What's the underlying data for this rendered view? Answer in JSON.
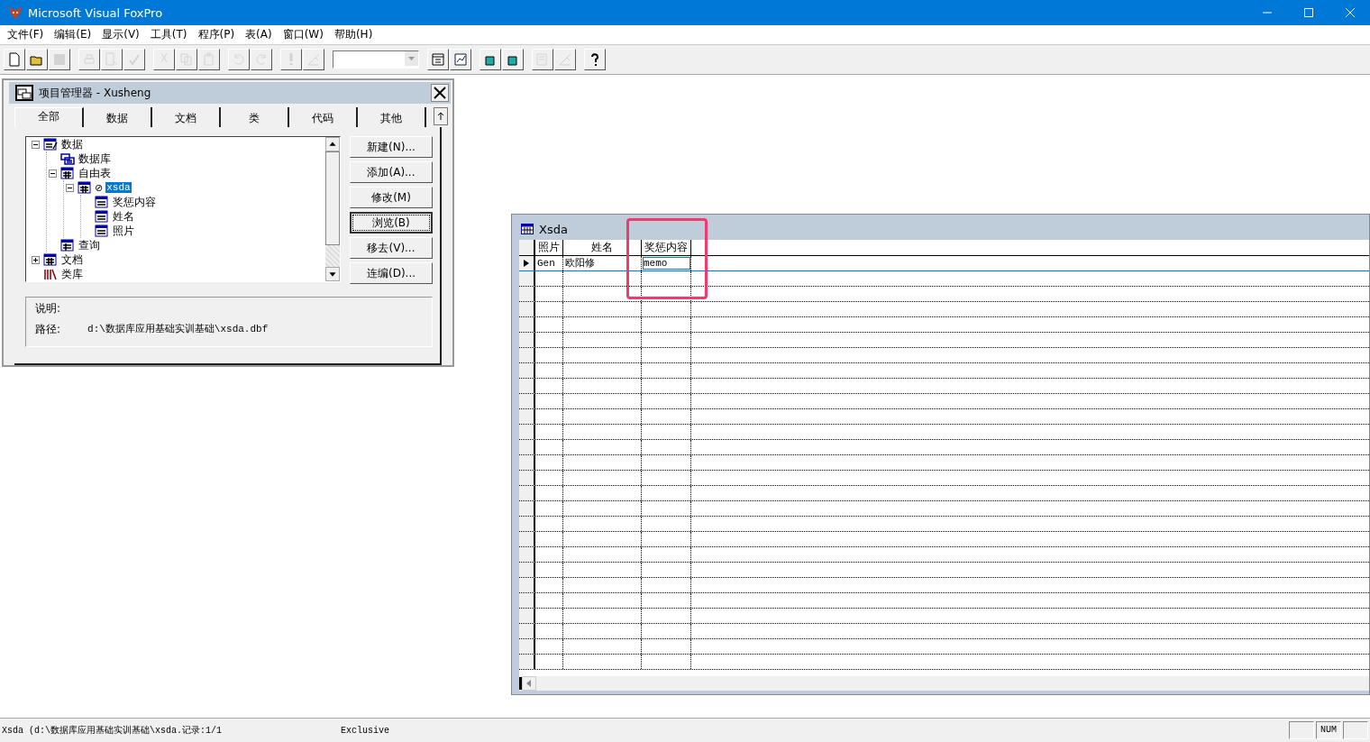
{
  "window": {
    "title": "Microsoft Visual FoxPro"
  },
  "menu": [
    "文件(F)",
    "编辑(E)",
    "显示(V)",
    "工具(T)",
    "程序(P)",
    "表(A)",
    "窗口(W)",
    "帮助(H)"
  ],
  "toolbar": [
    {
      "kind": "new",
      "disabled": false
    },
    {
      "kind": "open",
      "disabled": false
    },
    {
      "kind": "save",
      "disabled": true
    },
    {
      "kind": "sep"
    },
    {
      "kind": "print",
      "disabled": true
    },
    {
      "kind": "preview",
      "disabled": true
    },
    {
      "kind": "spell",
      "disabled": true
    },
    {
      "kind": "sep"
    },
    {
      "kind": "cut",
      "disabled": true
    },
    {
      "kind": "copy",
      "disabled": true
    },
    {
      "kind": "paste",
      "disabled": true
    },
    {
      "kind": "sep"
    },
    {
      "kind": "undo",
      "disabled": true
    },
    {
      "kind": "redo",
      "disabled": true
    },
    {
      "kind": "sep"
    },
    {
      "kind": "run",
      "disabled": true
    },
    {
      "kind": "modify",
      "disabled": true
    },
    {
      "kind": "sep"
    },
    {
      "kind": "combo"
    },
    {
      "kind": "sep"
    },
    {
      "kind": "window",
      "disabled": false
    },
    {
      "kind": "report",
      "disabled": false
    },
    {
      "kind": "sep"
    },
    {
      "kind": "wizard",
      "disabled": false
    },
    {
      "kind": "wizard",
      "disabled": false
    },
    {
      "kind": "sep"
    },
    {
      "kind": "form",
      "disabled": true
    },
    {
      "kind": "modify",
      "disabled": true
    },
    {
      "kind": "sep"
    },
    {
      "kind": "help",
      "disabled": false
    }
  ],
  "project": {
    "title": "项目管理器 - Xusheng",
    "tabs": [
      {
        "label": "全部",
        "selected": true
      },
      {
        "label": "数据",
        "selected": false
      },
      {
        "label": "文档",
        "selected": false
      },
      {
        "label": "类",
        "selected": false
      },
      {
        "label": "代码",
        "selected": false
      },
      {
        "label": "其他",
        "selected": false
      }
    ],
    "tree": [
      {
        "label": "数据",
        "kind": "data",
        "expanded": true,
        "selected": false,
        "children": [
          {
            "label": "数据库",
            "kind": "database",
            "selected": false
          },
          {
            "label": "自由表",
            "kind": "table",
            "expanded": true,
            "selected": false,
            "children": [
              {
                "label": "xsda",
                "kind": "table",
                "expanded": true,
                "prefix": "⊘",
                "selected": true,
                "children": [
                  {
                    "label": "奖惩内容",
                    "kind": "field",
                    "selected": false
                  },
                  {
                    "label": "姓名",
                    "kind": "field",
                    "selected": false
                  },
                  {
                    "label": "照片",
                    "kind": "field",
                    "selected": false
                  }
                ]
              }
            ]
          },
          {
            "label": "查询",
            "kind": "query",
            "selected": false
          }
        ]
      },
      {
        "label": "文档",
        "kind": "table",
        "expanded": false,
        "selected": false
      },
      {
        "label": "类库",
        "kind": "classlib",
        "selected": false
      }
    ],
    "buttons": [
      {
        "label": "新建(N)...",
        "focused": false
      },
      {
        "label": "添加(A)...",
        "focused": false
      },
      {
        "label": "修改(M)",
        "focused": false
      },
      {
        "label": "浏览(B)",
        "focused": true
      },
      {
        "label": "移去(V)...",
        "focused": false
      },
      {
        "label": "连编(D)...",
        "focused": false
      }
    ],
    "description_label": "说明:",
    "path_label": "路径:",
    "path": "d:\\数据库应用基础实训基础\\xsda.dbf"
  },
  "browse": {
    "title": "Xsda",
    "columns": [
      "照片",
      "姓名",
      "奖惩内容"
    ],
    "rows": [
      {
        "current": true,
        "cells": [
          {
            "text": "Gen",
            "selected": false
          },
          {
            "text": "欧阳修",
            "selected": false
          },
          {
            "text": "memo",
            "selected": true
          }
        ]
      }
    ]
  },
  "status_bar": {
    "record": "Xsda (d:\\数据库应用基础实训基础\\xsda.记录:1/1",
    "mode": "Exclusive",
    "num": "NUM"
  }
}
